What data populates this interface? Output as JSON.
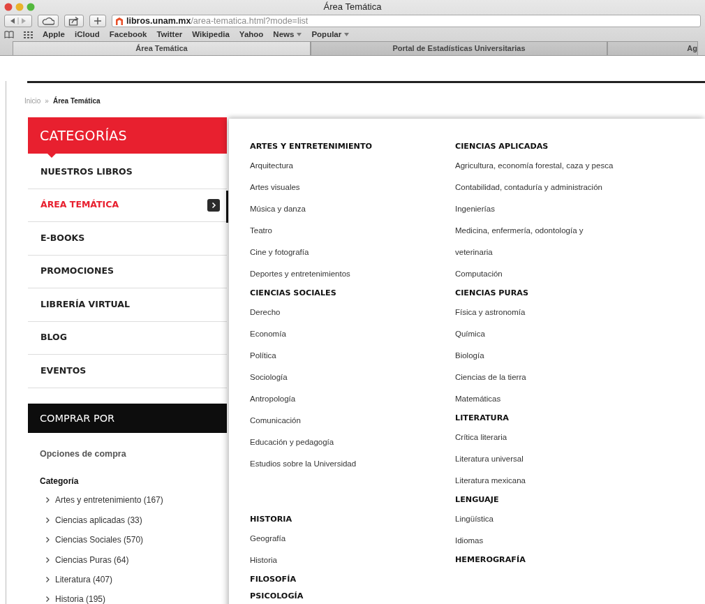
{
  "window": {
    "title": "Área Temática"
  },
  "address_bar": {
    "domain": "libros.unam.mx",
    "path": "/area-tematica.html?mode=list"
  },
  "bookmarks": [
    {
      "label": "Apple",
      "dropdown": false
    },
    {
      "label": "iCloud",
      "dropdown": false
    },
    {
      "label": "Facebook",
      "dropdown": false
    },
    {
      "label": "Twitter",
      "dropdown": false
    },
    {
      "label": "Wikipedia",
      "dropdown": false
    },
    {
      "label": "Yahoo",
      "dropdown": false
    },
    {
      "label": "News",
      "dropdown": true
    },
    {
      "label": "Popular",
      "dropdown": true
    }
  ],
  "tabs": [
    {
      "label": "Área Temática",
      "selected": true
    },
    {
      "label": "Portal de Estadísticas Universitarias",
      "selected": false
    },
    {
      "label": "Ag",
      "selected": false
    }
  ],
  "breadcrumb": [
    {
      "label": "Inicio",
      "current": false
    },
    {
      "label": "Área Temática",
      "current": true
    }
  ],
  "breadcrumb_separator": "»",
  "sidebar": {
    "title": "CATEGORÍAS",
    "items": [
      {
        "label": "NUESTROS LIBROS",
        "selected": false
      },
      {
        "label": "ÁREA TEMÁTICA",
        "selected": true
      },
      {
        "label": "E-BOOKS",
        "selected": false
      },
      {
        "label": "PROMOCIONES",
        "selected": false
      },
      {
        "label": "LIBRERÍA VIRTUAL",
        "selected": false
      },
      {
        "label": "BLOG",
        "selected": false
      },
      {
        "label": "EVENTOS",
        "selected": false
      }
    ]
  },
  "shop_by": {
    "title": "COMPRAR POR",
    "subtitle": "Opciones de compra",
    "filter_title": "Categoría",
    "items": [
      "Artes y entretenimiento (167)",
      "Ciencias aplicadas (33)",
      "Ciencias Sociales (570)",
      "Ciencias Puras (64)",
      "Literatura (407)",
      "Historia (195)"
    ]
  },
  "mega_menu": {
    "columns": [
      {
        "sections": [
          {
            "title": "ARTES Y ENTRETENIMIENTO",
            "items": [
              "Arquitectura",
              "Artes visuales",
              "Música y danza",
              "Teatro",
              "Cine y fotografía",
              "Deportes y entretenimientos"
            ]
          },
          {
            "title": "CIENCIAS SOCIALES",
            "items": [
              "Derecho",
              "Economía",
              "Política",
              "Sociología",
              "Antropología",
              "Comunicación",
              "Educación y pedagogía",
              "Estudios sobre la Universidad"
            ]
          },
          {
            "title": "HISTORIA",
            "items": [
              "Geografía",
              "Historia"
            ]
          },
          {
            "title": "FILOSOFÍA"
          },
          {
            "title": "PSICOLOGÍA"
          }
        ]
      },
      {
        "sections": [
          {
            "title": "CIENCIAS APLICADAS",
            "items": [
              "Agricultura, economía forestal, caza y pesca",
              "Contabilidad, contaduría y administración",
              "Ingenierías",
              "Medicina, enfermería, odontología y veterinaria",
              "Computación"
            ]
          },
          {
            "title": "CIENCIAS PURAS",
            "items": [
              "Física y astronomía",
              "Química",
              "Biología",
              "Ciencias de la tierra",
              "Matemáticas"
            ]
          },
          {
            "title": "LITERATURA",
            "items": [
              "Crítica literaria",
              "Literatura universal",
              "Literatura mexicana"
            ]
          },
          {
            "title": "LENGUAJE",
            "items": [
              "Lingüística",
              "Idiomas"
            ]
          },
          {
            "title": "HEMEROGRAFÍA"
          }
        ]
      }
    ]
  }
}
